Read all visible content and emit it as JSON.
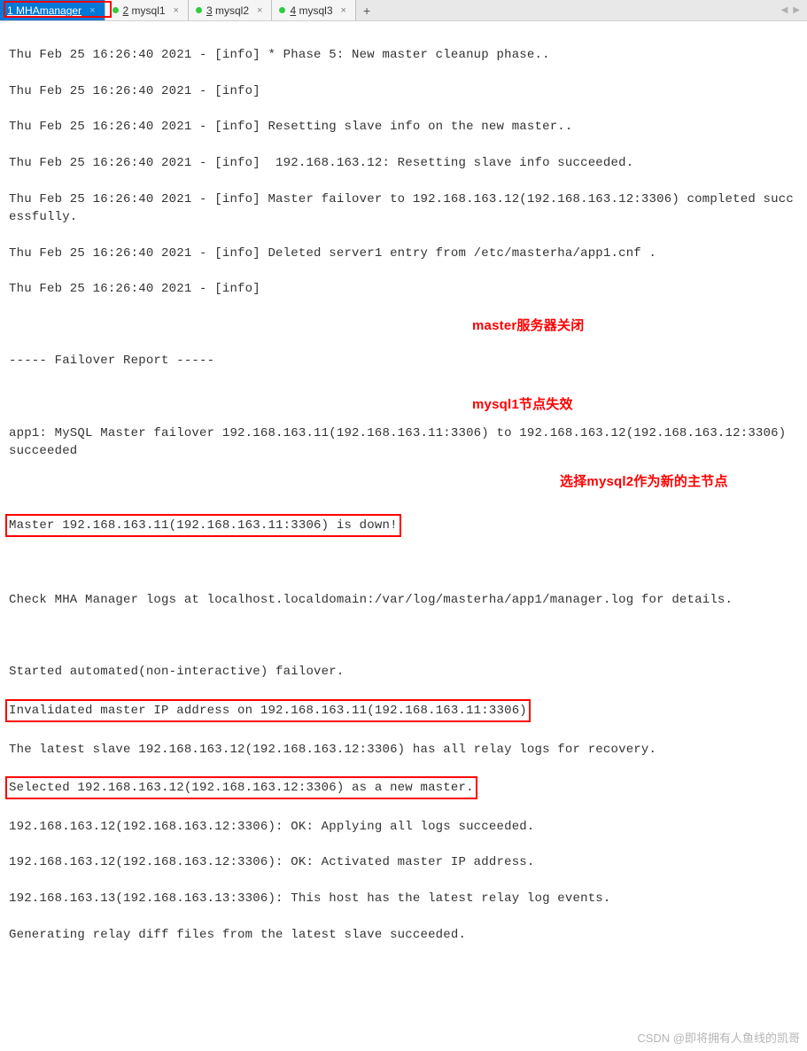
{
  "tabs": {
    "t1": {
      "num": "1",
      "label": "MHAmanager"
    },
    "t2": {
      "num": "2",
      "label": "mysql1"
    },
    "t3": {
      "num": "3",
      "label": "mysql2"
    },
    "t4": {
      "num": "4",
      "label": "mysql3"
    },
    "add": "+",
    "close": "×"
  },
  "nav": {
    "left": "◀",
    "right": "▶"
  },
  "log": {
    "l1": "Thu Feb 25 16:26:40 2021 - [info] * Phase 5: New master cleanup phase..",
    "l2": "Thu Feb 25 16:26:40 2021 - [info] ",
    "l3": "Thu Feb 25 16:26:40 2021 - [info] Resetting slave info on the new master..",
    "l4": "Thu Feb 25 16:26:40 2021 - [info]  192.168.163.12: Resetting slave info succeeded.",
    "l5": "Thu Feb 25 16:26:40 2021 - [info] Master failover to 192.168.163.12(192.168.163.12:3306) completed successfully.",
    "l6": "Thu Feb 25 16:26:40 2021 - [info] Deleted server1 entry from /etc/masterha/app1.cnf .",
    "l7": "Thu Feb 25 16:26:40 2021 - [info] ",
    "blank": " ",
    "l8": "----- Failover Report -----",
    "l9": "app1: MySQL Master failover 192.168.163.11(192.168.163.11:3306) to 192.168.163.12(192.168.163.12:3306) succeeded",
    "l10": "Master 192.168.163.11(192.168.163.11:3306) is down!",
    "l11": "Check MHA Manager logs at localhost.localdomain:/var/log/masterha/app1/manager.log for details.",
    "l12": "Started automated(non-interactive) failover.",
    "l13": "Invalidated master IP address on 192.168.163.11(192.168.163.11:3306)",
    "l14": "The latest slave 192.168.163.12(192.168.163.12:3306) has all relay logs for recovery.",
    "l15": "Selected 192.168.163.12(192.168.163.12:3306) as a new master.",
    "l16": "192.168.163.12(192.168.163.12:3306): OK: Applying all logs succeeded.",
    "l17": "192.168.163.12(192.168.163.12:3306): OK: Activated master IP address.",
    "l18": "192.168.163.13(192.168.163.13:3306): This host has the latest relay log events.",
    "l19": "Generating relay diff files from the latest slave succeeded."
  },
  "annotations": {
    "a1": "master服务器关闭",
    "a2": "mysql1节点失效",
    "a3": "选择mysql2作为新的主节点"
  },
  "watermark": "CSDN @即将拥有人鱼线的凯哥"
}
